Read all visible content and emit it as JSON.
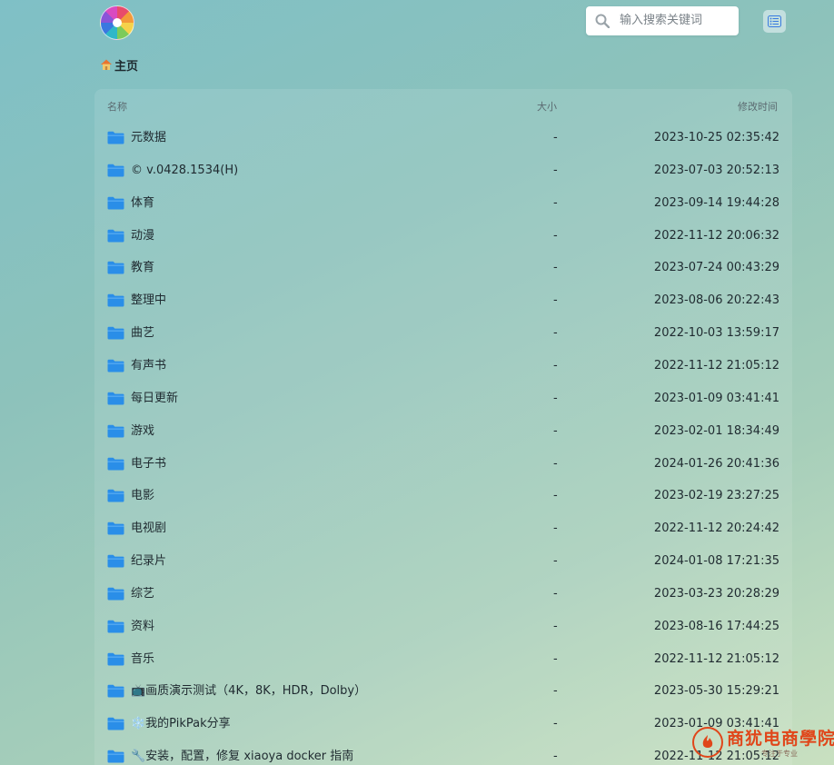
{
  "search": {
    "placeholder": "输入搜索关键词"
  },
  "breadcrumb": {
    "home_label": "主页"
  },
  "table": {
    "columns": {
      "name": "名称",
      "size": "大小",
      "modified": "修改时间"
    },
    "rows": [
      {
        "name": "元数据",
        "size": "-",
        "modified": "2023-10-25 02:35:42"
      },
      {
        "name": "© v.0428.1534(H)",
        "size": "-",
        "modified": "2023-07-03 20:52:13"
      },
      {
        "name": "体育",
        "size": "-",
        "modified": "2023-09-14 19:44:28"
      },
      {
        "name": "动漫",
        "size": "-",
        "modified": "2022-11-12 20:06:32"
      },
      {
        "name": "教育",
        "size": "-",
        "modified": "2023-07-24 00:43:29"
      },
      {
        "name": "整理中",
        "size": "-",
        "modified": "2023-08-06 20:22:43"
      },
      {
        "name": "曲艺",
        "size": "-",
        "modified": "2022-10-03 13:59:17"
      },
      {
        "name": "有声书",
        "size": "-",
        "modified": "2022-11-12 21:05:12"
      },
      {
        "name": "每日更新",
        "size": "-",
        "modified": "2023-01-09 03:41:41"
      },
      {
        "name": "游戏",
        "size": "-",
        "modified": "2023-02-01 18:34:49"
      },
      {
        "name": "电子书",
        "size": "-",
        "modified": "2024-01-26 20:41:36"
      },
      {
        "name": "电影",
        "size": "-",
        "modified": "2023-02-19 23:27:25"
      },
      {
        "name": "电视剧",
        "size": "-",
        "modified": "2022-11-12 20:24:42"
      },
      {
        "name": "纪录片",
        "size": "-",
        "modified": "2024-01-08 17:21:35"
      },
      {
        "name": "综艺",
        "size": "-",
        "modified": "2023-03-23 20:28:29"
      },
      {
        "name": "资料",
        "size": "-",
        "modified": "2023-08-16 17:44:25"
      },
      {
        "name": "音乐",
        "size": "-",
        "modified": "2022-11-12 21:05:12"
      },
      {
        "name": "📺画质演示测试（4K，8K，HDR，Dolby）",
        "size": "-",
        "modified": "2023-05-30 15:29:21"
      },
      {
        "name": "❄️我的PikPak分享",
        "size": "-",
        "modified": "2023-01-09 03:41:41"
      },
      {
        "name": "🔧安装，配置，修复 xiaoya docker 指南",
        "size": "-",
        "modified": "2022-11-12 21:05:12"
      }
    ]
  },
  "watermark": {
    "title": "商犹电商學院",
    "subtitle": "专注于专业"
  },
  "colors": {
    "folder": "#2a8ee8",
    "accent": "#3a7be0",
    "watermark": "#e0461a"
  },
  "icons": {
    "logo": "pinwheel-logo-icon",
    "search": "search-icon",
    "layout": "list-view-icon",
    "home": "home-icon",
    "folder": "folder-icon"
  }
}
